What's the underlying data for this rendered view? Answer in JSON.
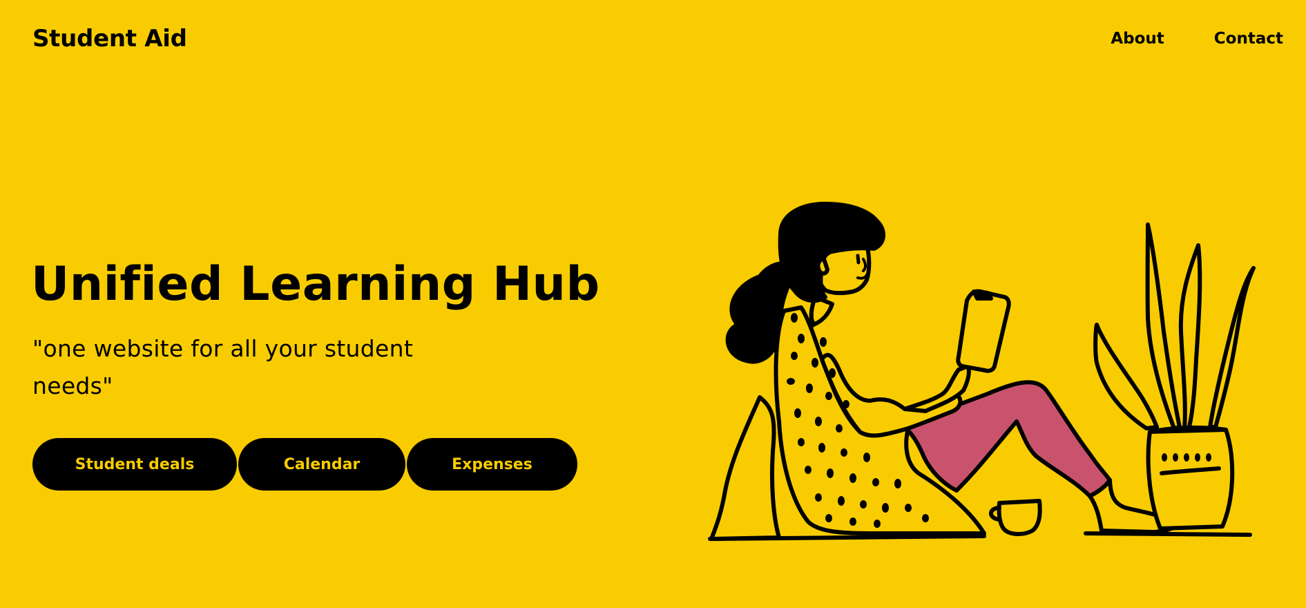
{
  "header": {
    "brand": "Student Aid",
    "nav": [
      "About",
      "Contact"
    ]
  },
  "hero": {
    "title": "Unified Learning Hub",
    "tagline": "\"one website for all your student needs\"",
    "buttons": [
      "Student deals",
      "Calendar",
      "Expenses"
    ]
  },
  "colors": {
    "background": "#F8CC00",
    "button_bg": "#000000",
    "button_text": "#F8CC00",
    "accent_pants": "#C9536C"
  },
  "illustration": {
    "icon": "student-reading-phone-illustration"
  }
}
